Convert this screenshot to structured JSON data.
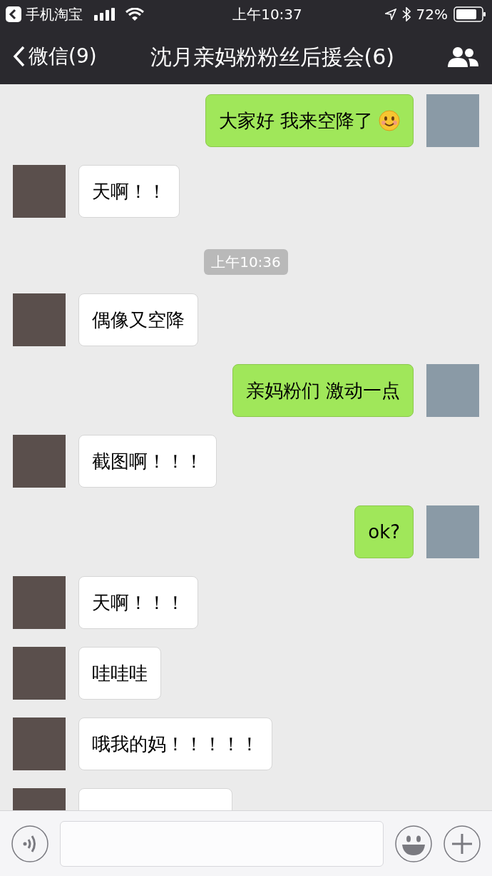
{
  "status_bar": {
    "back_app": "手机淘宝",
    "time": "上午10:37",
    "battery": "72%"
  },
  "nav": {
    "back": "微信(9)",
    "title": "沈月亲妈粉粉丝后援会(6)"
  },
  "messages": [
    {
      "kind": "sent",
      "text": "大家好 我来空降了",
      "emoji": true
    },
    {
      "kind": "received",
      "text": "天啊！！",
      "emoji": false
    },
    {
      "kind": "time",
      "text": "上午10:36"
    },
    {
      "kind": "received",
      "text": "偶像又空降",
      "emoji": false
    },
    {
      "kind": "sent",
      "text": "亲妈粉们 激动一点",
      "emoji": false
    },
    {
      "kind": "received",
      "text": "截图啊！！！",
      "emoji": false
    },
    {
      "kind": "sent",
      "text": "ok?",
      "emoji": false
    },
    {
      "kind": "received",
      "text": "天啊！！！",
      "emoji": false
    },
    {
      "kind": "received",
      "text": "哇哇哇",
      "emoji": false
    },
    {
      "kind": "received",
      "text": "哦我的妈！！！！！",
      "emoji": false
    },
    {
      "kind": "partial"
    }
  ]
}
